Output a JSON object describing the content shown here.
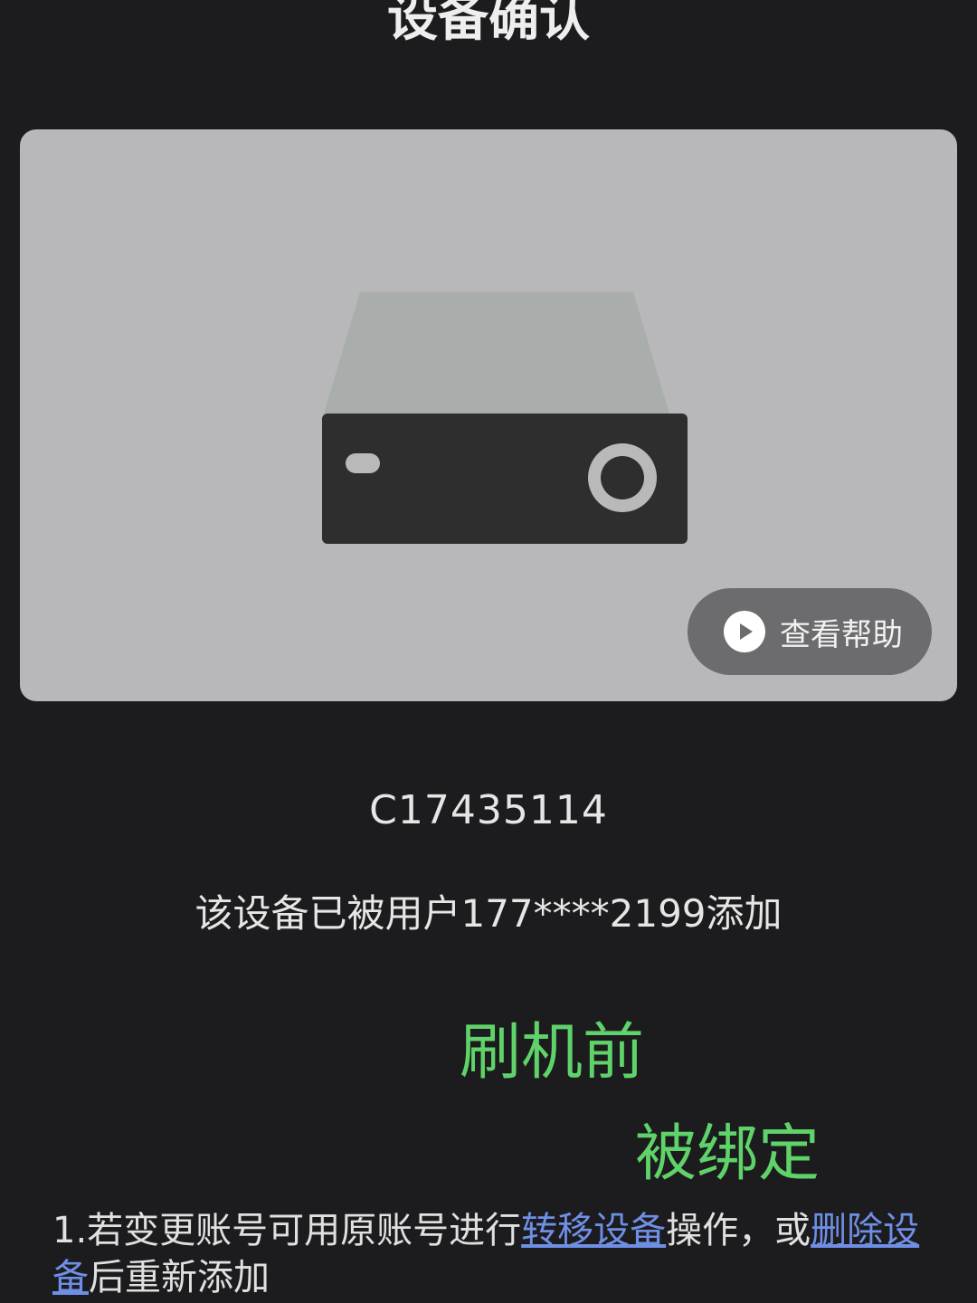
{
  "header": {
    "title": "设备确认"
  },
  "device_card": {
    "help_label": "查看帮助",
    "icons": {
      "device": "device-box-icon",
      "play": "play-icon"
    }
  },
  "device": {
    "id": "C17435114",
    "bound_message": "该设备已被用户177****2199添加"
  },
  "overlay": {
    "before_flash": "刷机前",
    "bound": "被绑定",
    "color": "#5fd36a"
  },
  "tip": {
    "prefix": "1.若变更账号可用原账号进行",
    "transfer_link": "转移设备",
    "middle": "操作，或",
    "delete_link": "删除设备",
    "suffix": "后重新添加"
  },
  "colors": {
    "background": "#1c1c1e",
    "card": "#b8b8ba",
    "link": "#6f8fe6"
  }
}
